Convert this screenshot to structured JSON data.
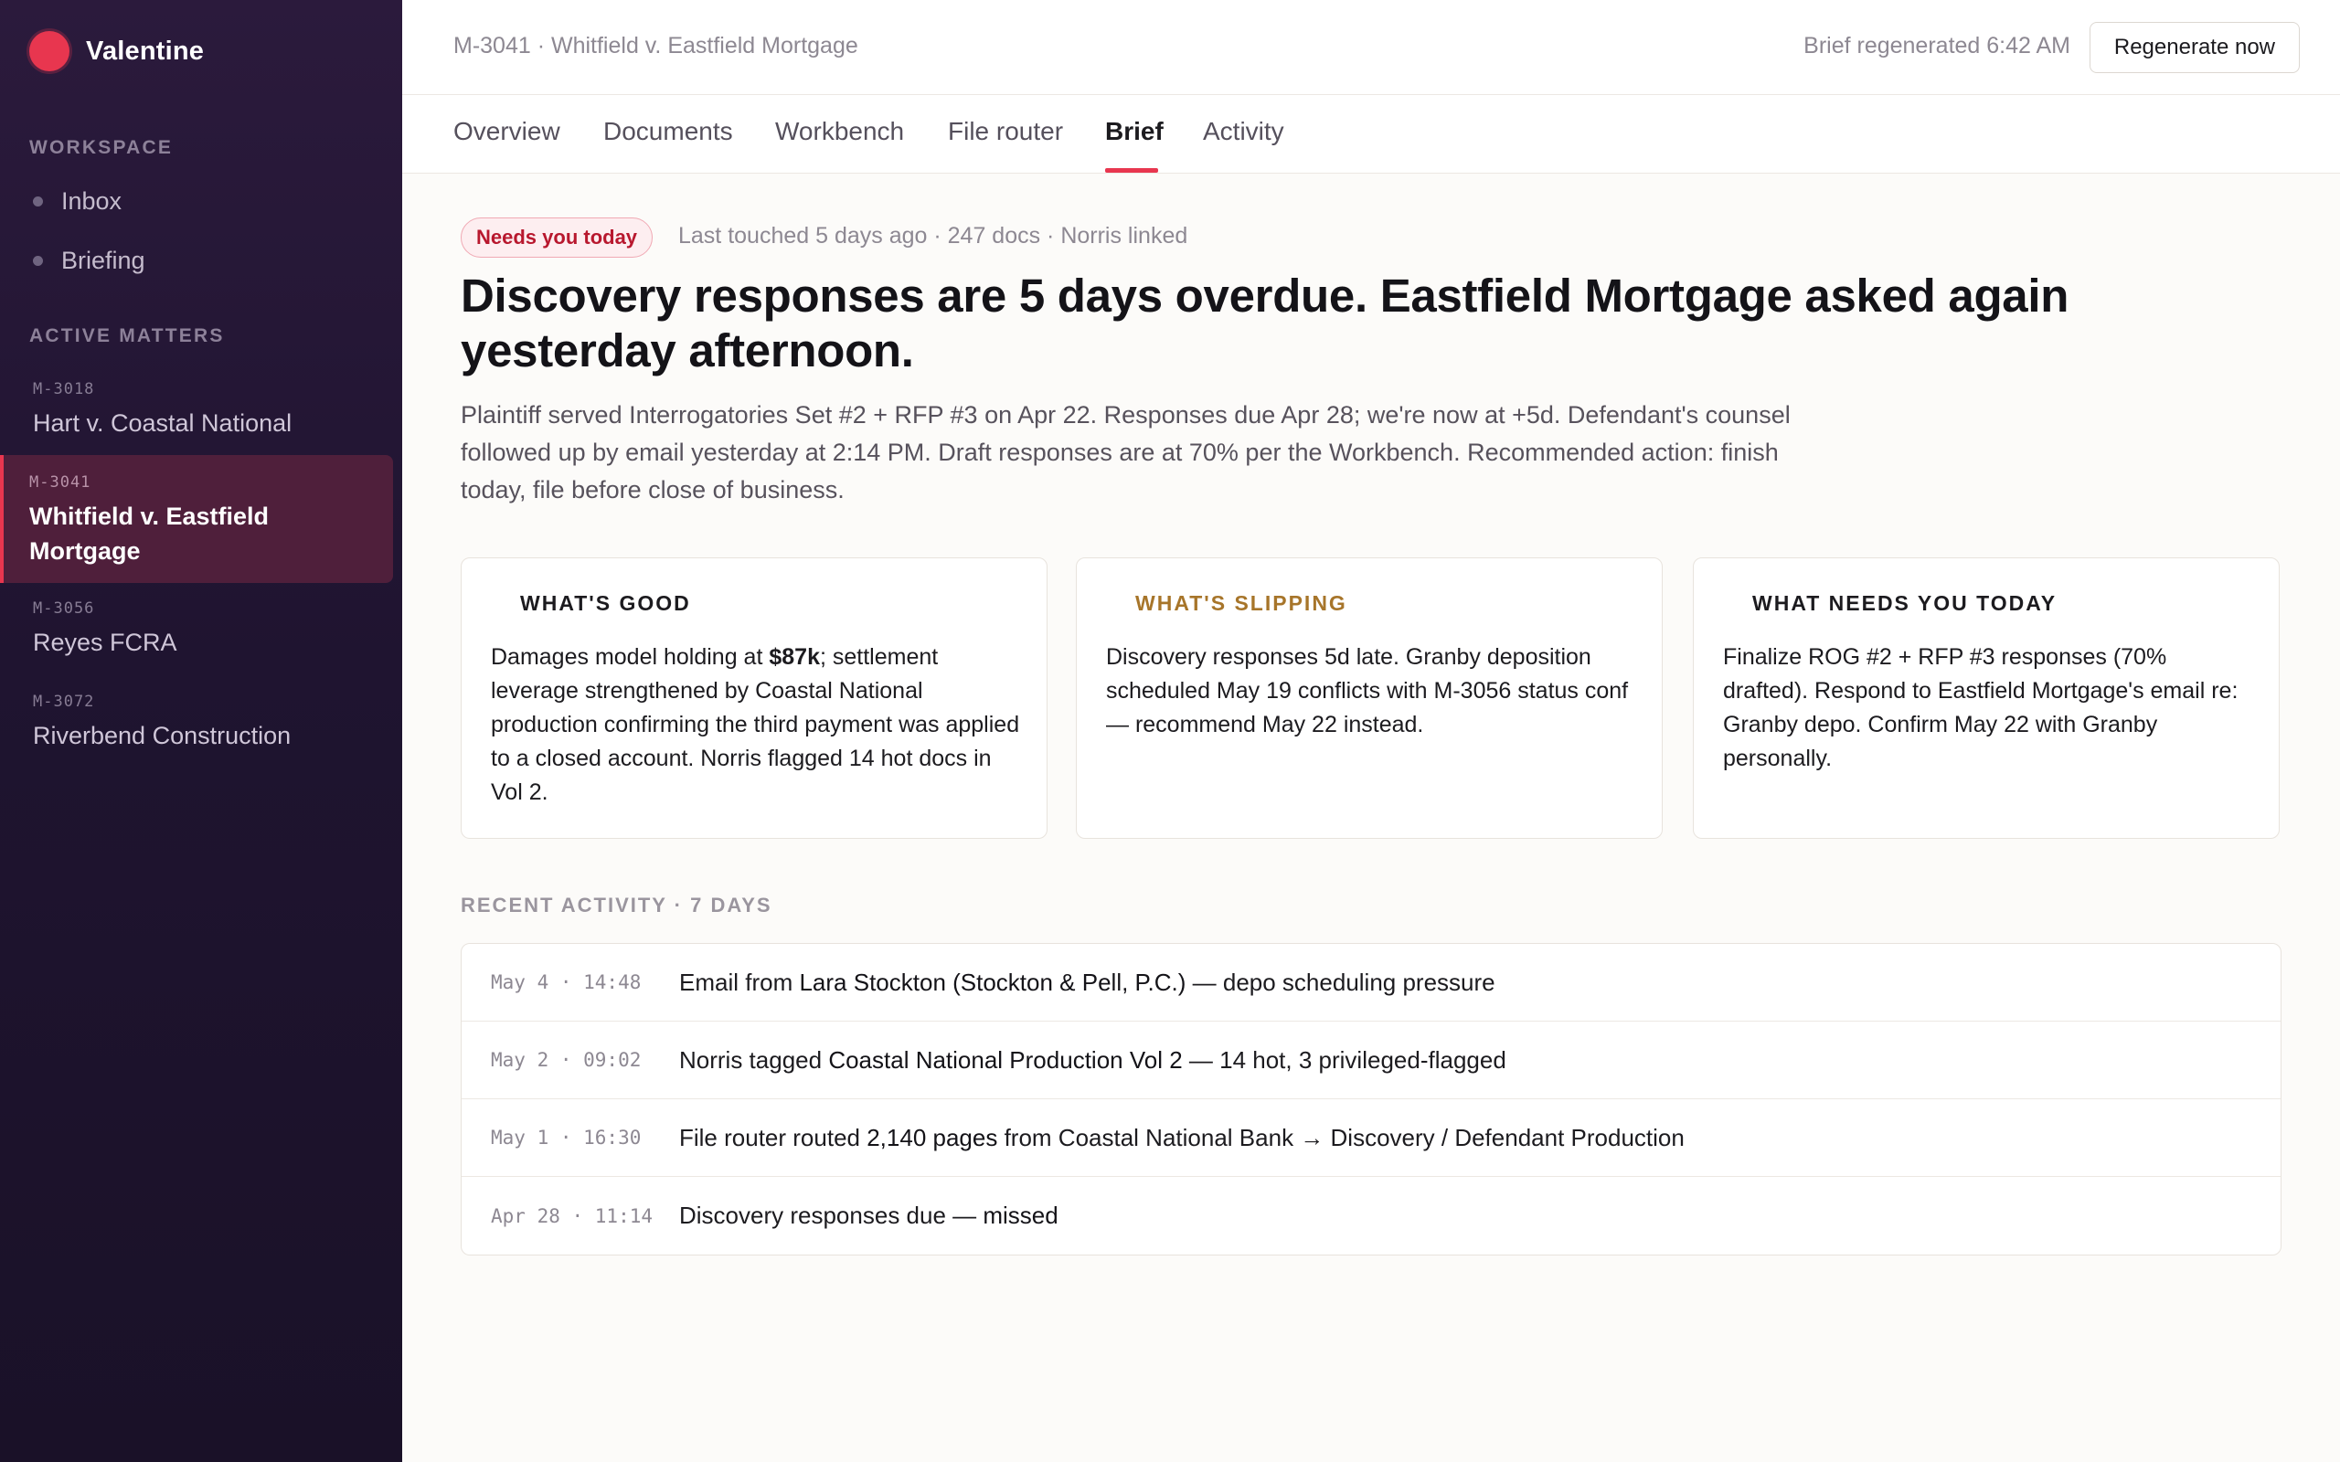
{
  "app": {
    "name": "Valentine",
    "brand_color": "#e8364f"
  },
  "sidebar": {
    "workspace_label": "WORKSPACE",
    "workspace_items": [
      {
        "label": "Inbox"
      },
      {
        "label": "Briefing"
      }
    ],
    "matters_label": "ACTIVE MATTERS",
    "matters": [
      {
        "code": "M-3018",
        "name": "Hart v. Coastal National",
        "active": false
      },
      {
        "code": "M-3041",
        "name": "Whitfield v. Eastfield Mortgage",
        "active": true
      },
      {
        "code": "M-3056",
        "name": "Reyes FCRA",
        "active": false
      },
      {
        "code": "M-3072",
        "name": "Riverbend Construction",
        "active": false
      }
    ]
  },
  "header": {
    "breadcrumb": "M-3041 · Whitfield v. Eastfield Mortgage",
    "regen_status": "Brief regenerated 6:42 AM",
    "regen_button": "Regenerate now"
  },
  "tabs": [
    {
      "label": "Overview",
      "active": false
    },
    {
      "label": "Documents",
      "active": false
    },
    {
      "label": "Workbench",
      "active": false
    },
    {
      "label": "File router",
      "active": false
    },
    {
      "label": "Brief",
      "active": true
    },
    {
      "label": "Activity",
      "active": false
    }
  ],
  "brief": {
    "badge": "Needs you today",
    "meta": "Last touched 5 days ago · 247 docs · Norris linked",
    "headline": "Discovery responses are 5 days overdue. Eastfield Mortgage asked again yesterday afternoon.",
    "summary": "Plaintiff served Interrogatories Set #2 + RFP #3 on Apr 22. Responses due Apr 28; we're now at +5d. Defendant's counsel followed up by email yesterday at 2:14 PM. Draft responses are at 70% per the Workbench. Recommended action: finish today, file before close of business."
  },
  "cards": {
    "good": {
      "title": "WHAT'S GOOD",
      "body_pre": "Damages model holding at ",
      "body_bold": "$87k",
      "body_post": "; settlement leverage strengthened by Coastal National production confirming the third payment was applied to a closed account. Norris flagged 14 hot docs in Vol 2."
    },
    "slipping": {
      "title": "WHAT'S SLIPPING",
      "title_color": "#a7752a",
      "body": "Discovery responses 5d late. Granby deposition scheduled May 19 conflicts with M-3056 status conf — recommend May 22 instead."
    },
    "today": {
      "title": "WHAT NEEDS YOU TODAY",
      "body": "Finalize ROG #2 + RFP #3 responses (70% drafted). Respond to Eastfield Mortgage's email re: Granby depo. Confirm May 22 with Granby personally."
    }
  },
  "recent": {
    "label": "RECENT ACTIVITY · 7 DAYS",
    "rows": [
      {
        "time": "May 4 · 14:48",
        "pre": "Email from ",
        "em": "Lara Stockton (Stockton & Pell, P.C.)",
        "post": " — depo scheduling pressure"
      },
      {
        "time": "May 2 · 09:02",
        "pre": "Norris tagged ",
        "em": "Coastal National Production Vol 2",
        "post": " — 14 hot, 3 privileged-flagged"
      },
      {
        "time": "May 1 · 16:30",
        "pre": "File router routed ",
        "em": "2,140 pages",
        "post": " from Coastal National Bank → Discovery / Defendant Production"
      },
      {
        "time": "Apr 28 · 11:14",
        "pre": "Discovery responses due — ",
        "em": "missed",
        "post": ""
      }
    ]
  }
}
